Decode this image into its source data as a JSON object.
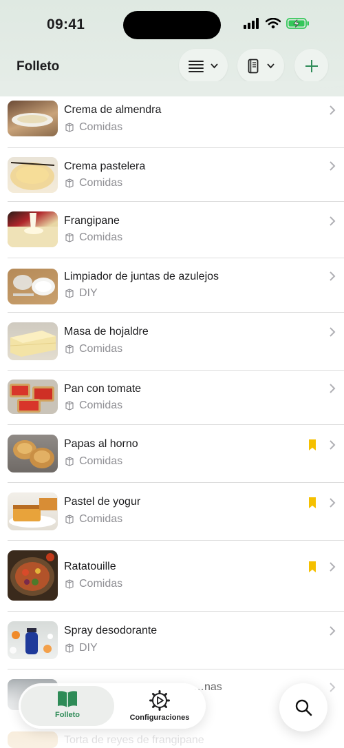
{
  "status": {
    "time": "09:41"
  },
  "header": {
    "title": "Folleto"
  },
  "items": [
    {
      "title": "Crema de almendra",
      "category": "Comidas",
      "bookmarked": false
    },
    {
      "title": "Crema pastelera",
      "category": "Comidas",
      "bookmarked": false
    },
    {
      "title": "Frangipane",
      "category": "Comidas",
      "bookmarked": false
    },
    {
      "title": "Limpiador de juntas de azulejos",
      "category": "DIY",
      "bookmarked": false
    },
    {
      "title": "Masa de hojaldre",
      "category": "Comidas",
      "bookmarked": false
    },
    {
      "title": "Pan con tomate",
      "category": "Comidas",
      "bookmarked": false
    },
    {
      "title": "Papas al horno",
      "category": "Comidas",
      "bookmarked": true
    },
    {
      "title": "Pastel de yogur",
      "category": "Comidas",
      "bookmarked": true
    },
    {
      "title": "Ratatouille",
      "category": "Comidas",
      "bookmarked": true
    },
    {
      "title": "Spray desodorante",
      "category": "DIY",
      "bookmarked": false
    },
    {
      "title": "…nas",
      "category": "",
      "bookmarked": false
    },
    {
      "title": "Torta de reyes de frangipane",
      "category": "",
      "bookmarked": false
    }
  ],
  "tabbar": {
    "folleto": "Folleto",
    "config": "Configuraciones"
  },
  "colors": {
    "accent": "#2e8b57",
    "bookmark": "#f5c000",
    "header_bg": "#dfe9e2"
  }
}
